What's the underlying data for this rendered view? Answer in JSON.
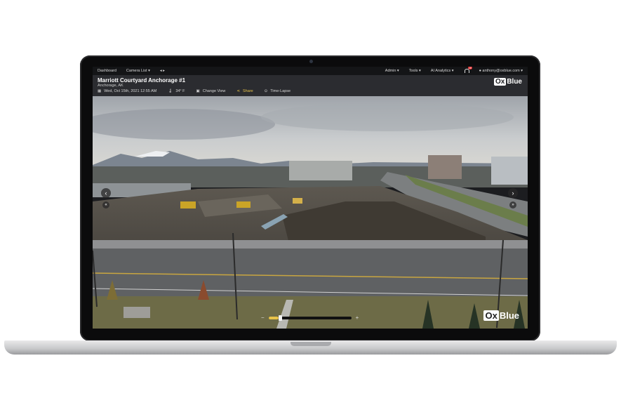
{
  "nav": {
    "dashboard": "Dashboard",
    "camera_list": "Camera List",
    "admin": "Admin",
    "tools": "Tools",
    "ai_analytics": "AI Analytics",
    "notifications_count": "28",
    "user": "anthony@oxblue.com"
  },
  "camera": {
    "title": "Marriott Courtyard Anchorage #1",
    "location": "Anchorage, AK",
    "datetime": "Wed, Oct 15th, 2021 12:55 AM",
    "temperature": "34° F"
  },
  "toolbar": {
    "change_view": "Change View",
    "share": "Share",
    "time_lapse": "Time-Lapse"
  },
  "logo": {
    "ox": "Ox",
    "blue": "Blue"
  },
  "zoom": {
    "minus": "−",
    "plus": "+",
    "level_fraction": 0.12
  },
  "colors": {
    "accent": "#e8c34a",
    "nav_bg": "#141517",
    "header_bg": "#2b2c30"
  },
  "icons": [
    "calendar-icon",
    "thermometer-icon",
    "change-view-icon",
    "share-icon",
    "time-lapse-icon",
    "bell-icon",
    "user-icon",
    "chevron-left-icon",
    "chevron-right-icon"
  ]
}
